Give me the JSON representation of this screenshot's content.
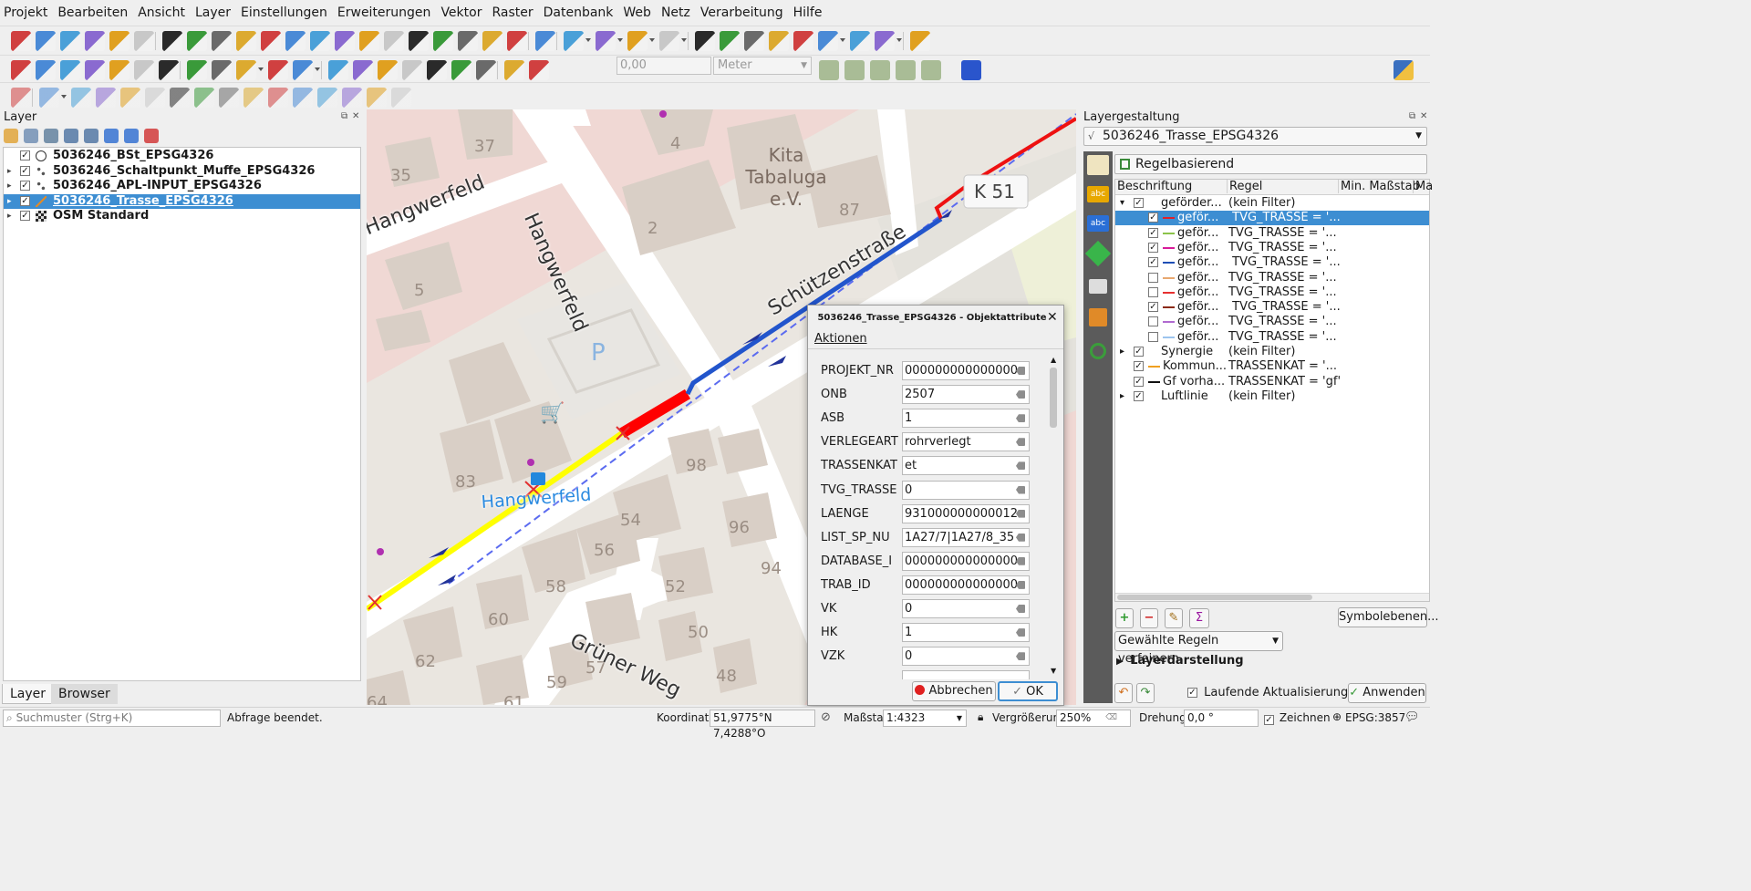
{
  "menu": [
    "Projekt",
    "Bearbeiten",
    "Ansicht",
    "Layer",
    "Einstellungen",
    "Erweiterungen",
    "Vektor",
    "Raster",
    "Datenbank",
    "Web",
    "Netz",
    "Verarbeitung",
    "Hilfe"
  ],
  "digitize_toolbar": {
    "value": "0,00",
    "unit": "Meter"
  },
  "layers_panel": {
    "title": "Layer",
    "layers": [
      {
        "name": "5036246_BSt_EPSG4326",
        "checked": true,
        "icon": "point-icon",
        "expandable": false
      },
      {
        "name": "5036246_Schaltpunkt_Muffe_EPSG4326",
        "checked": true,
        "icon": "multipoint-icon",
        "expandable": true
      },
      {
        "name": "5036246_APL-INPUT_EPSG4326",
        "checked": true,
        "icon": "multipoint-icon",
        "expandable": true
      },
      {
        "name": "5036246_Trasse_EPSG4326",
        "checked": true,
        "icon": "line-edit-icon",
        "expandable": true,
        "selected": true
      },
      {
        "name": "OSM Standard",
        "checked": true,
        "icon": "raster-icon",
        "expandable": true
      }
    ],
    "tabs": [
      "Layer",
      "Browser"
    ]
  },
  "map_labels": {
    "house_numbers": [
      "37",
      "4",
      "35",
      "87",
      "2",
      "5",
      "83",
      "98",
      "54",
      "96",
      "56",
      "94",
      "58",
      "52",
      "60",
      "50",
      "62",
      "57",
      "59",
      "48",
      "61",
      "64"
    ],
    "streets": [
      "Hangwerfeld",
      "Hangwerfeld",
      "Hangwerfeld",
      "Schützenstraße",
      "Grüner Weg"
    ],
    "poi_kita": "Kita\nTabaluga\ne.V.",
    "road_ref": "K 51",
    "parking": "P"
  },
  "style_panel": {
    "title": "Layergestaltung",
    "layer_select": "5036246_Trasse_EPSG4326",
    "renderer": "Regelbasierend",
    "columns": [
      "Beschriftung",
      "Regel",
      "Min. Maßstab",
      "Ma"
    ],
    "rules": [
      {
        "label": "geförder...",
        "rule": "(kein Filter)",
        "checked": true,
        "level": 0,
        "arrow": "▾",
        "color": ""
      },
      {
        "label": "geför...",
        "rule": " TVG_TRASSE = '...",
        "checked": true,
        "level": 1,
        "color": "#e0202a",
        "selected": true
      },
      {
        "label": "geför...",
        "rule": "TVG_TRASSE = '...",
        "checked": true,
        "level": 1,
        "color": "#8bc34a"
      },
      {
        "label": "geför...",
        "rule": "TVG_TRASSE = '...",
        "checked": true,
        "level": 1,
        "color": "#d81b9a"
      },
      {
        "label": "geför...",
        "rule": " TVG_TRASSE = '...",
        "checked": true,
        "level": 1,
        "color": "#1e4fb5"
      },
      {
        "label": "geför...",
        "rule": "TVG_TRASSE = '...",
        "checked": false,
        "level": 1,
        "color": "#e8a870"
      },
      {
        "label": "geför...",
        "rule": "TVG_TRASSE = '...",
        "checked": false,
        "level": 1,
        "color": "#e63030"
      },
      {
        "label": "geför...",
        "rule": " TVG_TRASSE = '...",
        "checked": true,
        "level": 1,
        "color": "#8b2a12"
      },
      {
        "label": "geför...",
        "rule": "TVG_TRASSE = '...",
        "checked": false,
        "level": 1,
        "color": "#b06ad0"
      },
      {
        "label": "geför...",
        "rule": "TVG_TRASSE = '...",
        "checked": false,
        "level": 1,
        "color": "#9cc4ee"
      },
      {
        "label": "Synergie",
        "rule": "(kein Filter)",
        "checked": true,
        "level": 0,
        "arrow": "▸",
        "color": ""
      },
      {
        "label": "Kommun...",
        "rule": "TRASSENKAT = '...",
        "checked": true,
        "level": 0,
        "color": "#f0a020"
      },
      {
        "label": "Gf vorha...",
        "rule": "TRASSENKAT = 'gf'",
        "checked": true,
        "level": 0,
        "color": "#111111"
      },
      {
        "label": "Luftlinie",
        "rule": "(kein Filter)",
        "checked": true,
        "level": 0,
        "arrow": "▸",
        "color": ""
      }
    ],
    "symbol_button": "Symbolebenen...",
    "refine_button": "Gewählte Regeln verfeinern",
    "layer_render": "Layerdarstellung",
    "live_update": "Laufende Aktualisierung",
    "apply": "Anwenden"
  },
  "dialog": {
    "title": "5036246_Trasse_EPSG4326 - Objektattribute",
    "menu": "Aktionen",
    "fields": [
      {
        "label": "PROJEKT_NR",
        "value": "000000000000000"
      },
      {
        "label": "ONB",
        "value": "2507"
      },
      {
        "label": "ASB",
        "value": "1"
      },
      {
        "label": "VERLEGEART",
        "value": "rohrverlegt"
      },
      {
        "label": "TRASSENKAT",
        "value": "et"
      },
      {
        "label": "TVG_TRASSE",
        "value": "0"
      },
      {
        "label": "LAENGE",
        "value": "931000000000012"
      },
      {
        "label": "LIST_SP_NU",
        "value": "1A27/7|1A27/8_35"
      },
      {
        "label": "DATABASE_I",
        "value": "000000000000000"
      },
      {
        "label": "TRAB_ID",
        "value": "000000000000000"
      },
      {
        "label": "VK",
        "value": "0"
      },
      {
        "label": "HK",
        "value": "1"
      },
      {
        "label": "VZK",
        "value": "0"
      }
    ],
    "cancel": "Abbrechen",
    "ok": "OK"
  },
  "statusbar": {
    "search_placeholder": "Suchmuster (Strg+K)",
    "message": "Abfrage beendet.",
    "coord_label": "Koordinate",
    "coord_value": "51,9775°N  7,4288°O",
    "scale_label": "Maßstab",
    "scale_value": "1:4323",
    "mag_label": "Vergrößerung",
    "mag_value": "250%",
    "rot_label": "Drehung",
    "rot_value": "0,0 °",
    "render_label": "Zeichnen",
    "crs": "EPSG:3857"
  }
}
